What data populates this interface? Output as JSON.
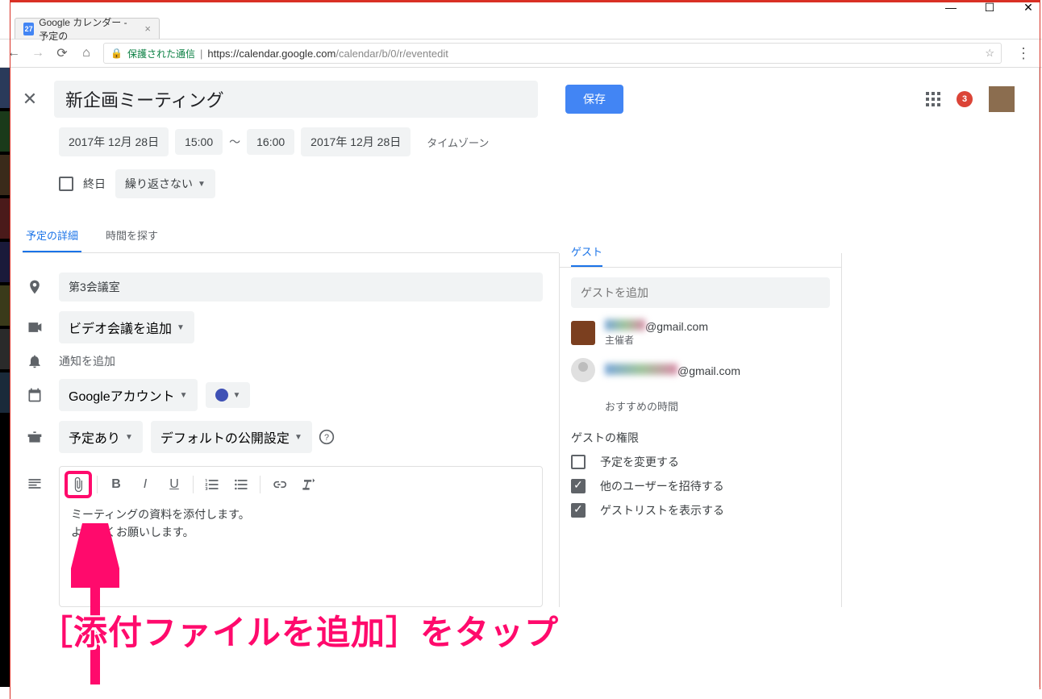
{
  "window": {
    "tab_title": "Google カレンダー - 予定の",
    "tab_icon_text": "27",
    "secure_label": "保護された通信",
    "url_host": "https://calendar.google.com",
    "url_path": "/calendar/b/0/r/eventedit",
    "notif_count": "3"
  },
  "event": {
    "title": "新企画ミーティング",
    "save": "保存",
    "date_start": "2017年 12月 28日",
    "time_start": "15:00",
    "time_sep": "〜",
    "time_end": "16:00",
    "date_end": "2017年 12月 28日",
    "timezone": "タイムゾーン",
    "allday": "終日",
    "repeat": "繰り返さない"
  },
  "tabs": {
    "details": "予定の詳細",
    "findtime": "時間を探す",
    "guests": "ゲスト"
  },
  "details": {
    "location": "第3会議室",
    "video": "ビデオ会議を追加",
    "notification": "通知を追加",
    "calendar": "Googleアカウント",
    "busy": "予定あり",
    "visibility": "デフォルトの公開設定",
    "desc_line1": "ミーティングの資料を添付します。",
    "desc_line2": "よろしくお願いします。"
  },
  "guests": {
    "placeholder": "ゲストを追加",
    "organizer_email": "@gmail.com",
    "organizer_label": "主催者",
    "guest1_email": "@gmail.com",
    "suggest": "おすすめの時間",
    "perm_title": "ゲストの権限",
    "perm1": "予定を変更する",
    "perm2": "他のユーザーを招待する",
    "perm3": "ゲストリストを表示する"
  },
  "annotation": "［添付ファイルを追加］をタップ"
}
